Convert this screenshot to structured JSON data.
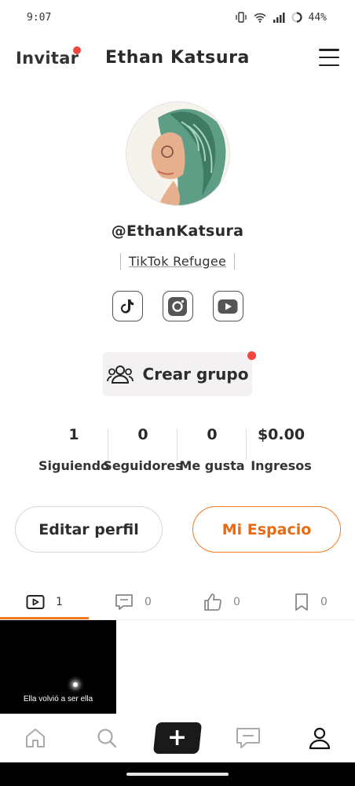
{
  "status_bar": {
    "time": "9:07",
    "battery": "44%"
  },
  "header": {
    "invite_label": "Invitar",
    "username": "Ethan Katsura"
  },
  "profile": {
    "handle": "@EthanKatsura",
    "bio": "TikTok Refugee",
    "socials": [
      "tiktok-icon",
      "instagram-icon",
      "youtube-icon"
    ],
    "create_group_label": "Crear grupo"
  },
  "stats": [
    {
      "value": "1",
      "label": "Siguiendo"
    },
    {
      "value": "0",
      "label": "Seguidores"
    },
    {
      "value": "0",
      "label": "Me gusta"
    },
    {
      "value": "$0.00",
      "label": "Ingresos"
    }
  ],
  "actions": {
    "edit_label": "Editar perfil",
    "space_label": "Mi Espacio"
  },
  "tabs": [
    {
      "icon": "video-icon",
      "count": "1"
    },
    {
      "icon": "comment-icon",
      "count": "0"
    },
    {
      "icon": "like-icon",
      "count": "0"
    },
    {
      "icon": "bookmark-icon",
      "count": "0"
    }
  ],
  "videos": [
    {
      "caption": "Ella volvió a ser ella"
    }
  ],
  "bottom_nav": [
    "home-icon",
    "search-icon",
    "plus-icon",
    "messages-icon",
    "profile-icon"
  ],
  "colors": {
    "accent": "#f07a22",
    "notification": "#f0463f"
  }
}
